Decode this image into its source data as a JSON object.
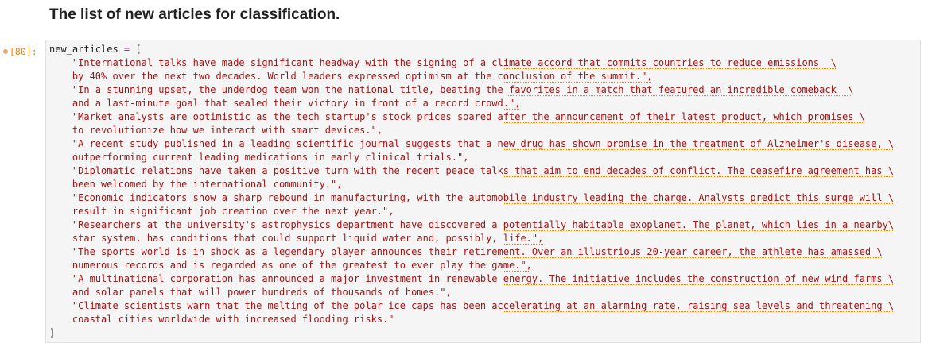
{
  "heading": "The list of new articles for classification.",
  "cell": {
    "prompt": "[80]:",
    "lines": [
      {
        "a": "new_articles ",
        "op": "=",
        "b": " [",
        "s": "",
        "u": ""
      },
      {
        "a": "    ",
        "op": "",
        "b": "",
        "s": "\"International talks have made significant headway with the signing of a cl",
        "u": "imate accord that commits countries to reduce emissions  \\"
      },
      {
        "a": "    ",
        "op": "",
        "b": "",
        "s": "by 40% over the next two decades. World leaders expressed optimism at the c",
        "u": "onclusion of the summit.\","
      },
      {
        "a": "    ",
        "op": "",
        "b": "",
        "s": "\"In a stunning upset, the underdog team won the national title, beating the ",
        "u": "favorites in a match that featured an incredible comeback  \\"
      },
      {
        "a": "    ",
        "op": "",
        "b": "",
        "s": "and a last-minute goal that sealed their victory in front of a record crowd",
        "u": ".\","
      },
      {
        "a": "    ",
        "op": "",
        "b": "",
        "s": "\"Market analysts are optimistic as the tech startup's stock prices soared a",
        "u": "fter the announcement of their latest product, which promises \\"
      },
      {
        "a": "    ",
        "op": "",
        "b": "",
        "s": "to revolutionize how we interact with smart devices.\",",
        "u": ""
      },
      {
        "a": "    ",
        "op": "",
        "b": "",
        "s": "\"A recent study published in a leading scientific journal suggests that a n",
        "u": "ew drug has shown promise in the treatment of Alzheimer's disease, \\"
      },
      {
        "a": "    ",
        "op": "",
        "b": "",
        "s": "outperforming current leading medications in early clinical trials.\",",
        "u": ""
      },
      {
        "a": "    ",
        "op": "",
        "b": "",
        "s": "\"Diplomatic relations have taken a positive turn with the recent peace talk",
        "u": "s that aim to end decades of conflict. The ceasefire agreement has \\"
      },
      {
        "a": "    ",
        "op": "",
        "b": "",
        "s": "been welcomed by the international community.\",",
        "u": ""
      },
      {
        "a": "    ",
        "op": "",
        "b": "",
        "s": "\"Economic indicators show a sharp rebound in manufacturing, with the automo",
        "u": "bile industry leading the charge. Analysts predict this surge will \\"
      },
      {
        "a": "    ",
        "op": "",
        "b": "",
        "s": "result in significant job creation over the next year.\",",
        "u": ""
      },
      {
        "a": "    ",
        "op": "",
        "b": "",
        "s": "\"Researchers at the university's astrophysics department have discovered a ",
        "u": "potentially habitable exoplanet. The planet, which lies in a nearby\\"
      },
      {
        "a": "    ",
        "op": "",
        "b": "",
        "s": "star system, has conditions that could support liquid water and, possibly, ",
        "u": "life.\","
      },
      {
        "a": "    ",
        "op": "",
        "b": "",
        "s": "\"The sports world is in shock as a legendary player announces their retirem",
        "u": "ent. Over an illustrious 20-year career, the athlete has amassed \\"
      },
      {
        "a": "    ",
        "op": "",
        "b": "",
        "s": "numerous records and is regarded as one of the greatest to ever play the ga",
        "u": "me.\","
      },
      {
        "a": "    ",
        "op": "",
        "b": "",
        "s": "\"A multinational corporation has announced a major investment in renewable ",
        "u": "energy. The initiative includes the construction of new wind farms \\"
      },
      {
        "a": "    ",
        "op": "",
        "b": "",
        "s": "and solar panels that will power hundreds of thousands of homes.\",",
        "u": ""
      },
      {
        "a": "    ",
        "op": "",
        "b": "",
        "s": "\"Climate scientists warn that the melting of the polar ice caps has been ac",
        "u": "celerating at an alarming rate, raising sea levels and threatening \\"
      },
      {
        "a": "    ",
        "op": "",
        "b": "",
        "s": "coastal cities worldwide with increased flooding risks.\"",
        "u": ""
      },
      {
        "a": "]",
        "op": "",
        "b": "",
        "s": "",
        "u": ""
      }
    ]
  }
}
